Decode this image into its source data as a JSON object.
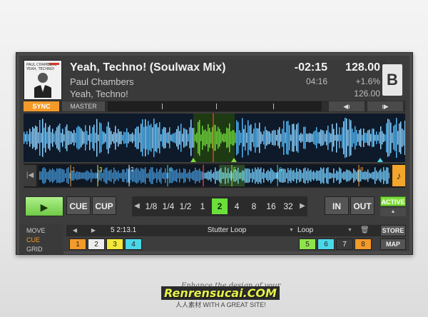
{
  "track": {
    "title": "Yeah, Techno! (Soulwax Mix)",
    "artist": "Paul Chambers",
    "album": "Yeah, Techno!",
    "time_remaining": "-02:15",
    "duration": "04:16",
    "bpm": "128.00",
    "pitch": "+1.6%",
    "tempo": "126.00",
    "deck_letter": "B",
    "cover_text": "PAUL CHAMBERS · YEAH, TECHNO!"
  },
  "sync_bar": {
    "sync_label": "SYNC",
    "master_label": "MASTER",
    "nudge_back_label": "◀ı",
    "nudge_fwd_label": "ı▶"
  },
  "transport": {
    "play_label": "▶",
    "cue_label": "CUE",
    "cup_label": "CUP",
    "in_label": "IN",
    "out_label": "OUT",
    "active_label": "ACTIVE",
    "active_arrow": "▲",
    "loop_sizes": [
      "1/8",
      "1/4",
      "1/2",
      "1",
      "2",
      "4",
      "8",
      "16",
      "32"
    ],
    "loop_selected": "2",
    "prev_arrow": "◀",
    "next_arrow": "▶"
  },
  "cue_panel": {
    "modes": [
      "MOVE",
      "CUE",
      "GRID"
    ],
    "mode_active": "CUE",
    "cue_position": "5  2:13.1",
    "cue_name": "Stutter Loop",
    "cue_type": "Loop",
    "store_label": "STORE",
    "map_label": "MAP",
    "hotcues": [
      {
        "label": "1",
        "color": "#f39a2a"
      },
      {
        "label": "2",
        "color": "#ececec"
      },
      {
        "label": "3",
        "color": "#f2e93a"
      },
      {
        "label": "4",
        "color": "#4ad7e8"
      },
      {
        "label": "5",
        "color": "#8ee34a"
      },
      {
        "label": "6",
        "color": "#4ad7e8"
      },
      {
        "label": "7",
        "color": "#3b3b3b"
      },
      {
        "label": "8",
        "color": "#f39a2a"
      }
    ]
  },
  "minimap": {
    "cue_markers": [
      "1",
      "3",
      "2",
      "4",
      "5",
      "6",
      "8"
    ]
  },
  "colors": {
    "accent_orange": "#f39a2a",
    "accent_green": "#7edb3a",
    "wave_blue": "#4fb6f5",
    "loop_green": "#5fbf2a"
  },
  "watermark": {
    "line1": "Enhance the design of your",
    "brand": "Renrensucai.COM",
    "line3": "人人素材 WITH A GREAT SITE!"
  }
}
